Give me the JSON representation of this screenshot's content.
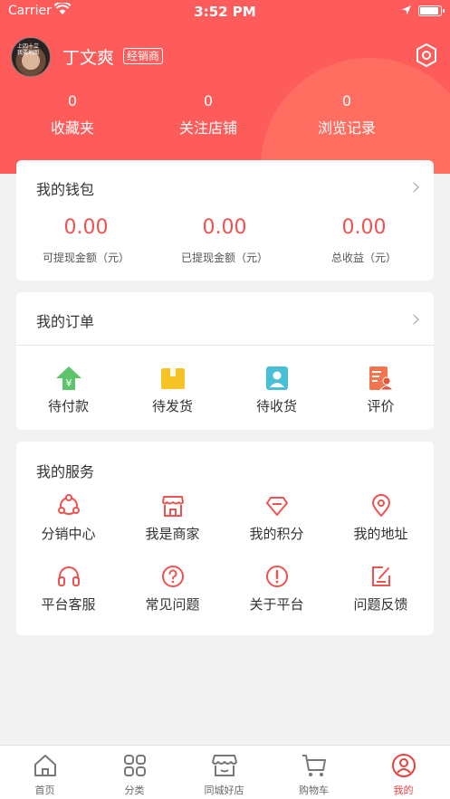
{
  "status_bar": {
    "carrier": "Carrier",
    "time": "3:52 PM"
  },
  "user": {
    "avatar_text_1": "上四十立",
    "avatar_text_2": "我要地图",
    "name": "丁文爽",
    "badge": "经销商"
  },
  "stats": [
    {
      "value": "0",
      "label": "收藏夹"
    },
    {
      "value": "0",
      "label": "关注店铺"
    },
    {
      "value": "0",
      "label": "浏览记录"
    }
  ],
  "wallet": {
    "title": "我的钱包",
    "items": [
      {
        "value": "0.00",
        "label": "可提现金额（元）"
      },
      {
        "value": "0.00",
        "label": "已提现金额（元）"
      },
      {
        "value": "0.00",
        "label": "总收益（元）"
      }
    ]
  },
  "orders": {
    "title": "我的订单",
    "items": [
      {
        "label": "待付款",
        "icon": "pending-payment-icon"
      },
      {
        "label": "待发货",
        "icon": "pending-shipment-icon"
      },
      {
        "label": "待收货",
        "icon": "pending-receipt-icon"
      },
      {
        "label": "评价",
        "icon": "review-icon"
      }
    ]
  },
  "services": {
    "title": "我的服务",
    "items": [
      {
        "label": "分销中心",
        "icon": "distribution-icon"
      },
      {
        "label": "我是商家",
        "icon": "shop-icon"
      },
      {
        "label": "我的积分",
        "icon": "diamond-icon"
      },
      {
        "label": "我的地址",
        "icon": "location-pin-icon"
      },
      {
        "label": "平台客服",
        "icon": "headset-icon"
      },
      {
        "label": "常见问题",
        "icon": "question-icon"
      },
      {
        "label": "关于平台",
        "icon": "info-icon"
      },
      {
        "label": "问题反馈",
        "icon": "feedback-icon"
      }
    ]
  },
  "tabs": [
    {
      "label": "首页",
      "icon": "home-icon"
    },
    {
      "label": "分类",
      "icon": "category-icon"
    },
    {
      "label": "同城好店",
      "icon": "store-icon"
    },
    {
      "label": "购物车",
      "icon": "cart-icon"
    },
    {
      "label": "我的",
      "icon": "profile-icon",
      "active": true
    }
  ],
  "colors": {
    "accent": "#fd5c5b",
    "price": "#ef5350",
    "active_tab": "#e8403f"
  }
}
